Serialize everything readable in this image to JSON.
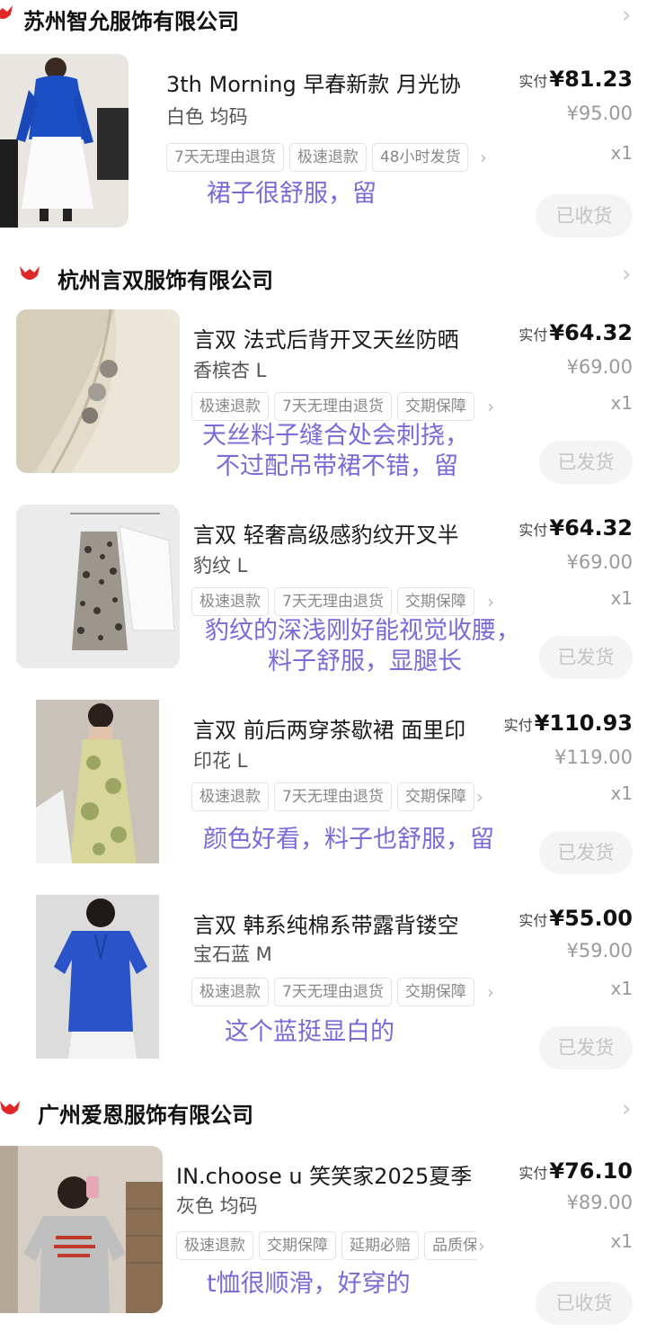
{
  "shops": [
    {
      "name": "苏州智允服饰有限公司",
      "logo_icon": "shop-logo-icon",
      "accent_color": "#e02626"
    },
    {
      "name": "杭州言双服饰有限公司",
      "logo_icon": "shop-logo-icon",
      "accent_color": "#e02626"
    },
    {
      "name": "广州爱恩服饰有限公司",
      "logo_icon": "shop-logo-icon",
      "accent_color": "#e02626"
    }
  ],
  "items": [
    {
      "title": "3th Morning 早春新款 月光协",
      "spec": "白色 均码",
      "tags": [
        "7天无理由退货",
        "极速退款",
        "48小时发货"
      ],
      "price_label": "实付",
      "price": "¥81.23",
      "original_price": "¥95.00",
      "quantity": "x1",
      "status": "已收货",
      "note_lines": [
        "裙子很舒服，留"
      ],
      "image": "blue-shirt-white-skirt-photo"
    },
    {
      "title": "言双 法式后背开叉天丝防晒",
      "spec": "香槟杏 L",
      "tags": [
        "极速退款",
        "7天无理由退货",
        "交期保障"
      ],
      "price_label": "实付",
      "price": "¥64.32",
      "original_price": "¥69.00",
      "quantity": "x1",
      "status": "已发货",
      "note_lines": [
        "天丝料子缝合处会刺挠，",
        "不过配吊带裙不错，留"
      ],
      "image": "beige-fabric-buttons-photo"
    },
    {
      "title": "言双 轻奢高级感豹纹开叉半",
      "spec": "豹纹 L",
      "tags": [
        "极速退款",
        "7天无理由退货",
        "交期保障"
      ],
      "price_label": "实付",
      "price": "¥64.32",
      "original_price": "¥69.00",
      "quantity": "x1",
      "status": "已发货",
      "note_lines": [
        "豹纹的深浅刚好能视觉收腰，",
        "料子舒服，显腿长"
      ],
      "image": "leopard-skirt-photo"
    },
    {
      "title": "言双 前后两穿茶歇裙 面里印",
      "spec": "印花 L",
      "tags": [
        "极速退款",
        "7天无理由退货",
        "交期保障"
      ],
      "price_label": "实付",
      "price": "¥110.93",
      "original_price": "¥119.00",
      "quantity": "x1",
      "status": "已发货",
      "note_lines": [
        "颜色好看，料子也舒服，留"
      ],
      "image": "floral-slip-dress-photo"
    },
    {
      "title": "言双 韩系纯棉系带露背镂空",
      "spec": "宝石蓝 M",
      "tags": [
        "极速退款",
        "7天无理由退货",
        "交期保障"
      ],
      "price_label": "实付",
      "price": "¥55.00",
      "original_price": "¥59.00",
      "quantity": "x1",
      "status": "已发货",
      "note_lines": [
        "这个蓝挺显白的"
      ],
      "image": "blue-backless-top-photo"
    },
    {
      "title": "IN.choose u 笑笑家2025夏季",
      "spec": "灰色 均码",
      "tags": [
        "极速退款",
        "交期保障",
        "延期必赔",
        "品质保障"
      ],
      "price_label": "实付",
      "price": "¥76.10",
      "original_price": "¥89.00",
      "quantity": "x1",
      "status": "已收货",
      "note_lines": [
        "t恤很顺滑，好穿的"
      ],
      "image": "grey-tshirt-selfie-photo"
    }
  ],
  "icons": {
    "shop_chevron": "›",
    "tags_chevron": "›"
  }
}
